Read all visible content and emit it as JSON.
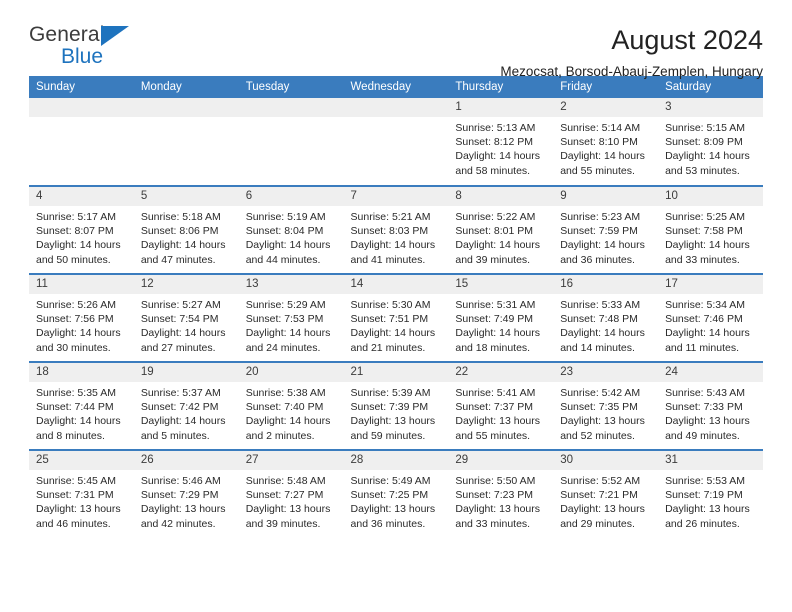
{
  "brand": {
    "line1": "General",
    "line2": "Blue",
    "triangle_icon": "triangle-icon",
    "colors": {
      "blue": "#1e73be",
      "dark": "#3c3c3c"
    }
  },
  "header": {
    "title": "August 2024",
    "subtitle": "Mezocsat, Borsod-Abauj-Zemplen, Hungary"
  },
  "theme": {
    "header_blue": "#3a7cbe",
    "daynum_gray": "#efefef"
  },
  "weekday_headers": [
    "Sunday",
    "Monday",
    "Tuesday",
    "Wednesday",
    "Thursday",
    "Friday",
    "Saturday"
  ],
  "labels": {
    "sunrise": "Sunrise:",
    "sunset": "Sunset:",
    "daylight": "Daylight:"
  },
  "weeks": [
    [
      {
        "empty": true,
        "day": ""
      },
      {
        "empty": true,
        "day": ""
      },
      {
        "empty": true,
        "day": ""
      },
      {
        "empty": true,
        "day": ""
      },
      {
        "empty": false,
        "day": "1",
        "sunrise": "Sunrise: 5:13 AM",
        "sunset": "Sunset: 8:12 PM",
        "daylight": "Daylight: 14 hours and 58 minutes."
      },
      {
        "empty": false,
        "day": "2",
        "sunrise": "Sunrise: 5:14 AM",
        "sunset": "Sunset: 8:10 PM",
        "daylight": "Daylight: 14 hours and 55 minutes."
      },
      {
        "empty": false,
        "day": "3",
        "sunrise": "Sunrise: 5:15 AM",
        "sunset": "Sunset: 8:09 PM",
        "daylight": "Daylight: 14 hours and 53 minutes."
      }
    ],
    [
      {
        "empty": false,
        "day": "4",
        "sunrise": "Sunrise: 5:17 AM",
        "sunset": "Sunset: 8:07 PM",
        "daylight": "Daylight: 14 hours and 50 minutes."
      },
      {
        "empty": false,
        "day": "5",
        "sunrise": "Sunrise: 5:18 AM",
        "sunset": "Sunset: 8:06 PM",
        "daylight": "Daylight: 14 hours and 47 minutes."
      },
      {
        "empty": false,
        "day": "6",
        "sunrise": "Sunrise: 5:19 AM",
        "sunset": "Sunset: 8:04 PM",
        "daylight": "Daylight: 14 hours and 44 minutes."
      },
      {
        "empty": false,
        "day": "7",
        "sunrise": "Sunrise: 5:21 AM",
        "sunset": "Sunset: 8:03 PM",
        "daylight": "Daylight: 14 hours and 41 minutes."
      },
      {
        "empty": false,
        "day": "8",
        "sunrise": "Sunrise: 5:22 AM",
        "sunset": "Sunset: 8:01 PM",
        "daylight": "Daylight: 14 hours and 39 minutes."
      },
      {
        "empty": false,
        "day": "9",
        "sunrise": "Sunrise: 5:23 AM",
        "sunset": "Sunset: 7:59 PM",
        "daylight": "Daylight: 14 hours and 36 minutes."
      },
      {
        "empty": false,
        "day": "10",
        "sunrise": "Sunrise: 5:25 AM",
        "sunset": "Sunset: 7:58 PM",
        "daylight": "Daylight: 14 hours and 33 minutes."
      }
    ],
    [
      {
        "empty": false,
        "day": "11",
        "sunrise": "Sunrise: 5:26 AM",
        "sunset": "Sunset: 7:56 PM",
        "daylight": "Daylight: 14 hours and 30 minutes."
      },
      {
        "empty": false,
        "day": "12",
        "sunrise": "Sunrise: 5:27 AM",
        "sunset": "Sunset: 7:54 PM",
        "daylight": "Daylight: 14 hours and 27 minutes."
      },
      {
        "empty": false,
        "day": "13",
        "sunrise": "Sunrise: 5:29 AM",
        "sunset": "Sunset: 7:53 PM",
        "daylight": "Daylight: 14 hours and 24 minutes."
      },
      {
        "empty": false,
        "day": "14",
        "sunrise": "Sunrise: 5:30 AM",
        "sunset": "Sunset: 7:51 PM",
        "daylight": "Daylight: 14 hours and 21 minutes."
      },
      {
        "empty": false,
        "day": "15",
        "sunrise": "Sunrise: 5:31 AM",
        "sunset": "Sunset: 7:49 PM",
        "daylight": "Daylight: 14 hours and 18 minutes."
      },
      {
        "empty": false,
        "day": "16",
        "sunrise": "Sunrise: 5:33 AM",
        "sunset": "Sunset: 7:48 PM",
        "daylight": "Daylight: 14 hours and 14 minutes."
      },
      {
        "empty": false,
        "day": "17",
        "sunrise": "Sunrise: 5:34 AM",
        "sunset": "Sunset: 7:46 PM",
        "daylight": "Daylight: 14 hours and 11 minutes."
      }
    ],
    [
      {
        "empty": false,
        "day": "18",
        "sunrise": "Sunrise: 5:35 AM",
        "sunset": "Sunset: 7:44 PM",
        "daylight": "Daylight: 14 hours and 8 minutes."
      },
      {
        "empty": false,
        "day": "19",
        "sunrise": "Sunrise: 5:37 AM",
        "sunset": "Sunset: 7:42 PM",
        "daylight": "Daylight: 14 hours and 5 minutes."
      },
      {
        "empty": false,
        "day": "20",
        "sunrise": "Sunrise: 5:38 AM",
        "sunset": "Sunset: 7:40 PM",
        "daylight": "Daylight: 14 hours and 2 minutes."
      },
      {
        "empty": false,
        "day": "21",
        "sunrise": "Sunrise: 5:39 AM",
        "sunset": "Sunset: 7:39 PM",
        "daylight": "Daylight: 13 hours and 59 minutes."
      },
      {
        "empty": false,
        "day": "22",
        "sunrise": "Sunrise: 5:41 AM",
        "sunset": "Sunset: 7:37 PM",
        "daylight": "Daylight: 13 hours and 55 minutes."
      },
      {
        "empty": false,
        "day": "23",
        "sunrise": "Sunrise: 5:42 AM",
        "sunset": "Sunset: 7:35 PM",
        "daylight": "Daylight: 13 hours and 52 minutes."
      },
      {
        "empty": false,
        "day": "24",
        "sunrise": "Sunrise: 5:43 AM",
        "sunset": "Sunset: 7:33 PM",
        "daylight": "Daylight: 13 hours and 49 minutes."
      }
    ],
    [
      {
        "empty": false,
        "day": "25",
        "sunrise": "Sunrise: 5:45 AM",
        "sunset": "Sunset: 7:31 PM",
        "daylight": "Daylight: 13 hours and 46 minutes."
      },
      {
        "empty": false,
        "day": "26",
        "sunrise": "Sunrise: 5:46 AM",
        "sunset": "Sunset: 7:29 PM",
        "daylight": "Daylight: 13 hours and 42 minutes."
      },
      {
        "empty": false,
        "day": "27",
        "sunrise": "Sunrise: 5:48 AM",
        "sunset": "Sunset: 7:27 PM",
        "daylight": "Daylight: 13 hours and 39 minutes."
      },
      {
        "empty": false,
        "day": "28",
        "sunrise": "Sunrise: 5:49 AM",
        "sunset": "Sunset: 7:25 PM",
        "daylight": "Daylight: 13 hours and 36 minutes."
      },
      {
        "empty": false,
        "day": "29",
        "sunrise": "Sunrise: 5:50 AM",
        "sunset": "Sunset: 7:23 PM",
        "daylight": "Daylight: 13 hours and 33 minutes."
      },
      {
        "empty": false,
        "day": "30",
        "sunrise": "Sunrise: 5:52 AM",
        "sunset": "Sunset: 7:21 PM",
        "daylight": "Daylight: 13 hours and 29 minutes."
      },
      {
        "empty": false,
        "day": "31",
        "sunrise": "Sunrise: 5:53 AM",
        "sunset": "Sunset: 7:19 PM",
        "daylight": "Daylight: 13 hours and 26 minutes."
      }
    ]
  ]
}
